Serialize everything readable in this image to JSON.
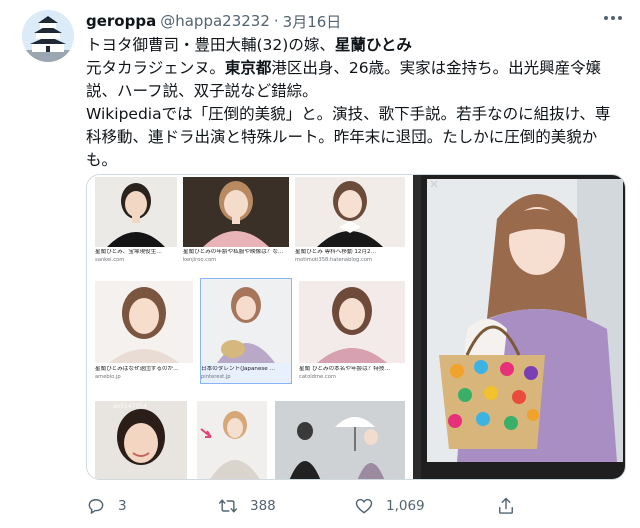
{
  "tweet": {
    "display_name": "geroppa",
    "handle": "@happa23232",
    "dot": "·",
    "date": "3月16日",
    "more_icon": "more-dots-icon",
    "text": {
      "l1_a": "トヨタ御曹司・豊田大輔(32)の嫁、",
      "l1_b": "星蘭ひとみ",
      "l2_a": "元タカラジェンヌ。",
      "l2_b": "東京都",
      "l2_c": "港区出身、26歳。実家は金持ち。出光興産令嬢",
      "l3": "説、ハーフ説、双子説など錯綜。",
      "l4": "Wikipediaでは「圧倒的美貌」と。演技、歌下手説。若手なのに組抜け、専",
      "l5": "科移動、連ドラ出演と特殊ルート。昨年末に退団。たしかに圧倒的美貌か",
      "l6": "も。"
    }
  },
  "image_results": [
    {
      "caption": "星蘭ひとみ、宝塚現役生…",
      "source": "sankei.com"
    },
    {
      "caption": "星蘭ひとみの年齢や私服や映像は？な…",
      "source": "kenjiroo.com"
    },
    {
      "caption": "星蘭ひとみ 専科へ移動 12月2…",
      "source": "motimoti358.hatenablog.com"
    },
    {
      "caption": "星蘭ひとみはなぜ退団するのか…",
      "source": "ameblo.jp"
    },
    {
      "caption": "日本のタレント(Japanese …",
      "source": "pinterest.jp"
    },
    {
      "caption": "星蘭 ひとみの本名や年齢は？特技…",
      "source": "catoldme.com"
    },
    {
      "caption": "",
      "source": ""
    },
    {
      "caption": "",
      "source": ""
    },
    {
      "caption": "",
      "source": ""
    }
  ],
  "watermark": "av5147054",
  "close_icon": "close-icon",
  "actions": {
    "reply": {
      "icon": "reply-icon",
      "count": "3"
    },
    "retweet": {
      "icon": "retweet-icon",
      "count": "388"
    },
    "like": {
      "icon": "heart-icon",
      "count": "1,069"
    },
    "share": {
      "icon": "share-icon"
    }
  },
  "colors": {
    "text": "#0f1419",
    "secondary": "#536471",
    "border": "#cfd9de",
    "selected": "#8ab4f8"
  }
}
